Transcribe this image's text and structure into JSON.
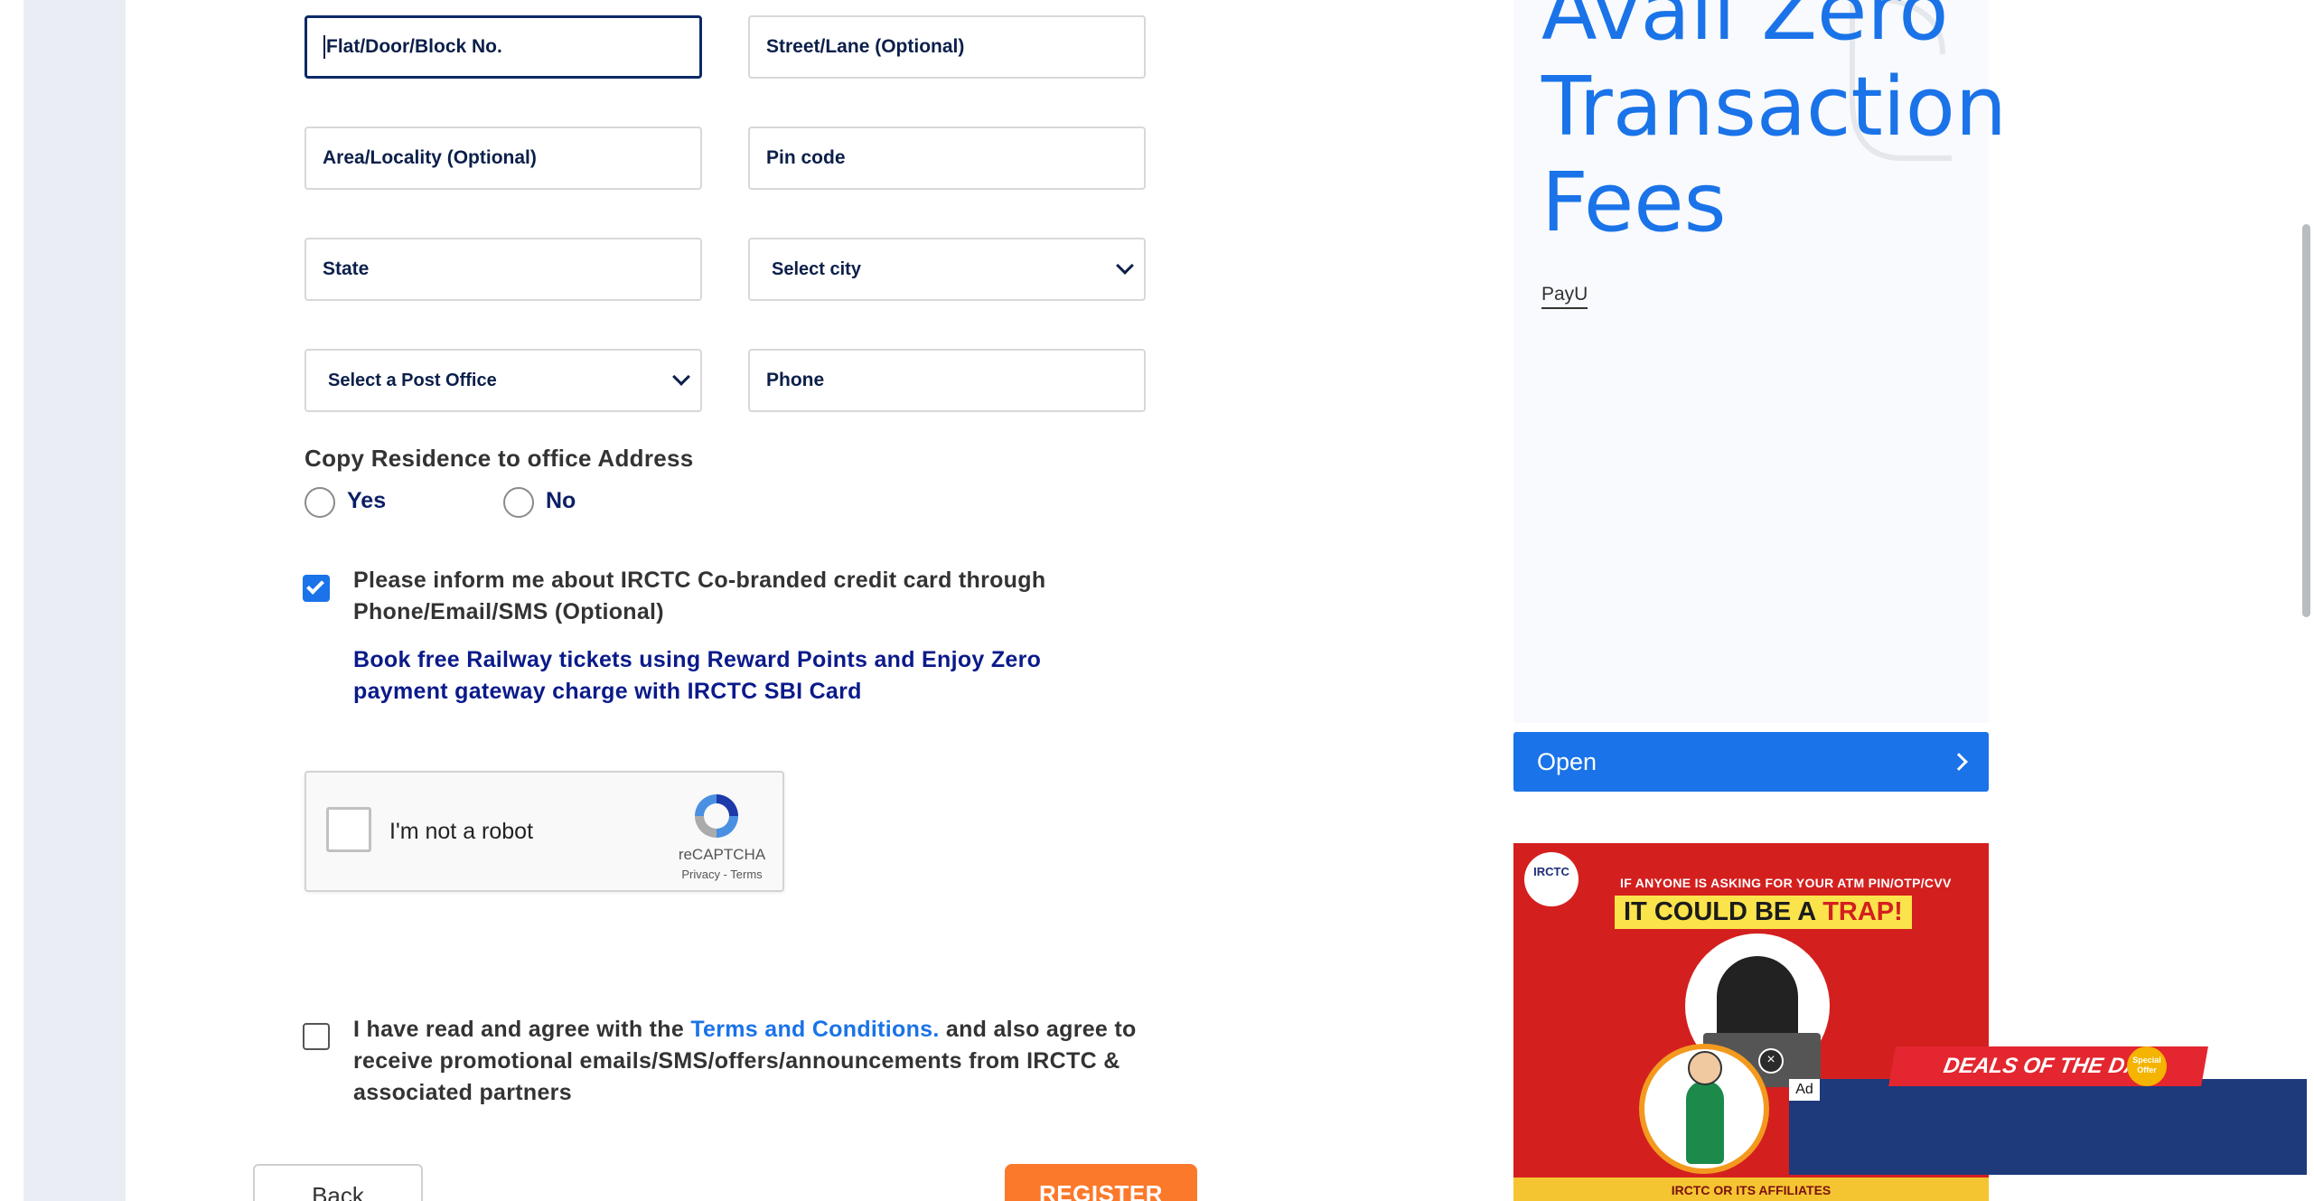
{
  "form": {
    "flat_placeholder": "Flat/Door/Block No.",
    "street_placeholder": "Street/Lane (Optional)",
    "area_placeholder": "Area/Locality (Optional)",
    "pin_placeholder": "Pin code",
    "state_placeholder": "State",
    "city_select": "Select city",
    "post_office_select": "Select a Post Office",
    "phone_placeholder": "Phone",
    "copy_address_label": "Copy Residence to office Address",
    "copy_yes": "Yes",
    "copy_no": "No",
    "inform_text": "Please inform me about IRCTC Co-branded credit card through Phone/Email/SMS (Optional)",
    "promo_text": "Book free Railway tickets using Reward Points and Enjoy Zero payment gateway charge with IRCTC SBI Card",
    "agree_prefix": "I have read and agree with the",
    "terms_link": "Terms and Conditions.",
    "agree_suffix": "and also agree to receive promotional emails/SMS/offers/announcements from IRCTC & associated partners",
    "inform_checked": true,
    "agree_checked": false,
    "back_label": "Back",
    "register_label": "REGISTER"
  },
  "recaptcha": {
    "label": "I'm not a robot",
    "brand": "reCAPTCHA",
    "links": "Privacy - Terms"
  },
  "ads": {
    "headline_line1": "Avail Zero",
    "headline_line2": "Transaction",
    "headline_line3": "Fees",
    "advertiser": "PayU",
    "open_label": "Open",
    "irctc_logo": "IRCTC",
    "irctc_small": "IF ANYONE IS ASKING FOR YOUR ATM PIN/OTP/CVV",
    "irctc_big_prefix": "IT COULD BE A",
    "irctc_big_highlight": "TRAP!",
    "irctc_footer": "IRCTC OR ITS AFFILIATES",
    "deals_label": "DEALS OF THE DAY",
    "special_offer": "Special Offer",
    "ad_tag": "Ad",
    "close_symbol": "×"
  },
  "colors": {
    "accent": "#1a73e8",
    "navy": "#0b1f4a",
    "register": "#fb792b",
    "promo": "#0a1a8a"
  },
  "icons": {
    "select_chevron": "chevron-down-icon",
    "open_chevron": "chevron-right-icon",
    "recaptcha": "recaptcha-logo-icon",
    "checkmark": "checkmark-icon"
  }
}
